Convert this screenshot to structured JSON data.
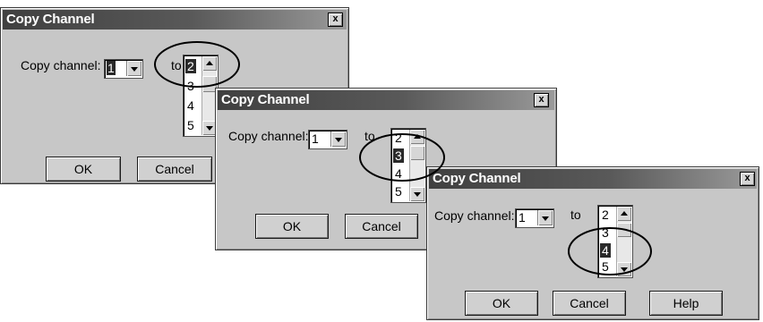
{
  "dialogs": [
    {
      "title": "Copy Channel",
      "close_glyph": "x",
      "copy_label": "Copy channel:",
      "source_value": "1",
      "to_label": "to",
      "list_items": [
        "2",
        "3",
        "4",
        "5"
      ],
      "selected_item": "2",
      "buttons": {
        "ok": "OK",
        "cancel": "Cancel"
      }
    },
    {
      "title": "Copy Channel",
      "close_glyph": "x",
      "copy_label": "Copy channel:",
      "source_value": "1",
      "to_label": "to",
      "list_items": [
        "2",
        "3",
        "4",
        "5"
      ],
      "selected_item": "3",
      "buttons": {
        "ok": "OK",
        "cancel": "Cancel"
      }
    },
    {
      "title": "Copy Channel",
      "close_glyph": "x",
      "copy_label": "Copy channel:",
      "source_value": "1",
      "to_label": "to",
      "list_items": [
        "2",
        "3",
        "4",
        "5"
      ],
      "selected_item": "4",
      "buttons": {
        "ok": "OK",
        "cancel": "Cancel",
        "help": "Help"
      }
    }
  ],
  "colors": {
    "dialog_face": "#c7c7c7",
    "selection": "#2a2a2a",
    "highlight_ring": "#000000"
  }
}
